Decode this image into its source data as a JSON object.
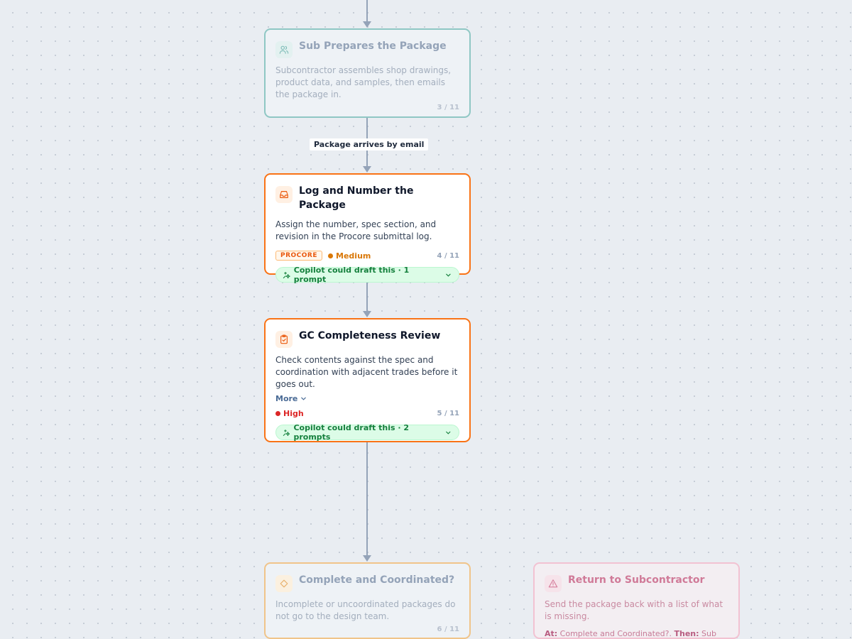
{
  "edges": {
    "package_label": "Package arrives by email"
  },
  "nodes": [
    {
      "title": "Sub Prepares the Package",
      "description": "Subcontractor assembles shop drawings, product data, and samples, then emails the package in.",
      "step": "3 / 11",
      "icon": "users-icon"
    },
    {
      "title": "Log and Number the Package",
      "description": "Assign the number, spec section, and revision in the Procore submittal log.",
      "badge": "PROCORE",
      "priority": "Medium",
      "step": "4 / 11",
      "copilot": "Copilot could draft this · 1 prompt",
      "icon": "inbox-icon"
    },
    {
      "title": "GC Completeness Review",
      "description": "Check contents against the spec and coordination with adjacent trades before it goes out.",
      "more": "More",
      "priority": "High",
      "step": "5 / 11",
      "copilot": "Copilot could draft this · 2 prompts",
      "icon": "clipboard-check-icon"
    },
    {
      "title": "Complete and Coordinated?",
      "description": "Incomplete or uncoordinated packages do not go to the design team.",
      "step": "6 / 11",
      "icon": "diamond-icon"
    },
    {
      "title": "Return to Subcontractor",
      "description": "Send the package back with a list of what is missing.",
      "at_label": "At:",
      "at_value": "Complete and Coordinated?.",
      "then_label": "Then:",
      "then_value": "Sub corrects and resends.",
      "icon": "warning-icon"
    }
  ],
  "colors": {
    "teal_border": "#8fc7c4",
    "orange_border": "#f97316",
    "amber_border": "#f0c48a",
    "pink_border": "#f2c2d2",
    "medium": "#d97706",
    "high": "#dc2626",
    "copilot_green": "#15803d"
  }
}
